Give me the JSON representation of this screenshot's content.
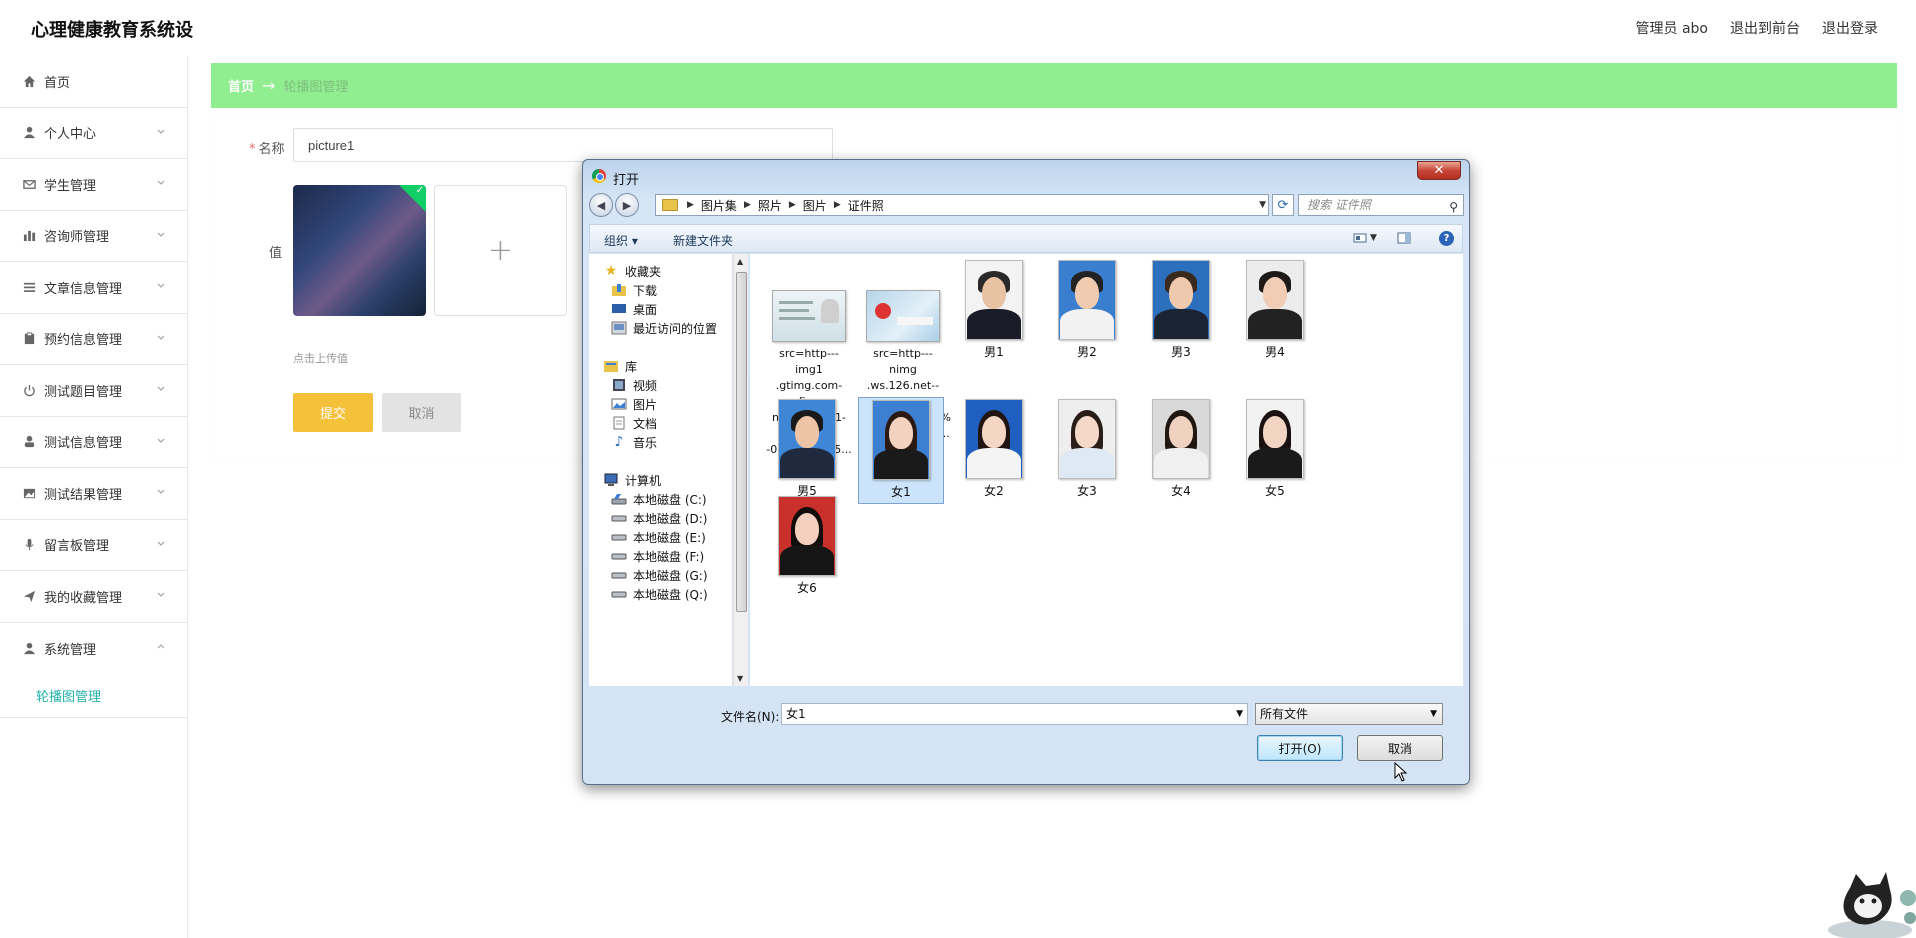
{
  "header": {
    "app_title": "心理健康教育系统设",
    "user_label": "管理员 abo",
    "to_front": "退出到前台",
    "logout": "退出登录"
  },
  "sidebar": {
    "items": [
      {
        "label": "首页",
        "icon": "home-icon"
      },
      {
        "label": "个人中心",
        "icon": "user-icon"
      },
      {
        "label": "学生管理",
        "icon": "mail-icon"
      },
      {
        "label": "咨询师管理",
        "icon": "chart-icon"
      },
      {
        "label": "文章信息管理",
        "icon": "list-icon"
      },
      {
        "label": "预约信息管理",
        "icon": "clipboard-icon"
      },
      {
        "label": "测试题目管理",
        "icon": "power-icon"
      },
      {
        "label": "测试信息管理",
        "icon": "person-icon"
      },
      {
        "label": "测试结果管理",
        "icon": "picture-icon"
      },
      {
        "label": "留言板管理",
        "icon": "mic-icon"
      },
      {
        "label": "我的收藏管理",
        "icon": "send-icon"
      },
      {
        "label": "系统管理",
        "icon": "user-icon"
      }
    ],
    "sub_item": "轮播图管理"
  },
  "breadcrumb": {
    "home": "首页",
    "arrow": "→",
    "current": "轮播图管理"
  },
  "form": {
    "name_label": "名称",
    "name_value": "picture1",
    "value_label": "值",
    "upload_plus": "+",
    "upload_hint": "点击上传值",
    "submit": "提交",
    "cancel": "取消"
  },
  "dialog": {
    "title": "打开",
    "close": "✕",
    "path": [
      "图片集",
      "照片",
      "图片",
      "证件照"
    ],
    "search_placeholder": "搜索 证件照",
    "toolbar": {
      "organize": "组织 ▾",
      "new_folder": "新建文件夹"
    },
    "tree": {
      "favorites": "收藏夹",
      "downloads": "下载",
      "desktop": "桌面",
      "recent": "最近访问的位置",
      "libraries": "库",
      "videos": "视频",
      "pictures": "图片",
      "documents": "文档",
      "music": "音乐",
      "computer": "计算机",
      "drives": [
        "本地磁盘 (C:)",
        "本地磁盘 (D:)",
        "本地磁盘 (E:)",
        "本地磁盘 (F:)",
        "本地磁盘 (G:)",
        "本地磁盘 (Q:)"
      ]
    },
    "files": [
      {
        "name": "src=http---img1\n.gtimg.com-fina\nnce-pics-hv1-61\n-0-634-41225...",
        "kind": "idcard"
      },
      {
        "name": "src=http---nimg\n.ws.126.net--url\n=http%3A%2F%\n2Fdingyue.ws....",
        "kind": "idcard2"
      },
      {
        "name": "男1",
        "kind": "m"
      },
      {
        "name": "男2",
        "kind": "m"
      },
      {
        "name": "男3",
        "kind": "m"
      },
      {
        "name": "男4",
        "kind": "m"
      },
      {
        "name": "男5",
        "kind": "m"
      },
      {
        "name": "女1",
        "kind": "f",
        "selected": true
      },
      {
        "name": "女2",
        "kind": "f"
      },
      {
        "name": "女3",
        "kind": "f"
      },
      {
        "name": "女4",
        "kind": "f"
      },
      {
        "name": "女5",
        "kind": "f"
      },
      {
        "name": "女6",
        "kind": "f"
      }
    ],
    "filename_label": "文件名(N):",
    "filename_value": "女1",
    "filetype": "所有文件",
    "open_button": "打开(O)",
    "cancel_button": "取消"
  },
  "colors": {
    "breadcrumb_bg": "#90ee90",
    "submit": "#f5c13b",
    "accent": "#20b2aa"
  }
}
